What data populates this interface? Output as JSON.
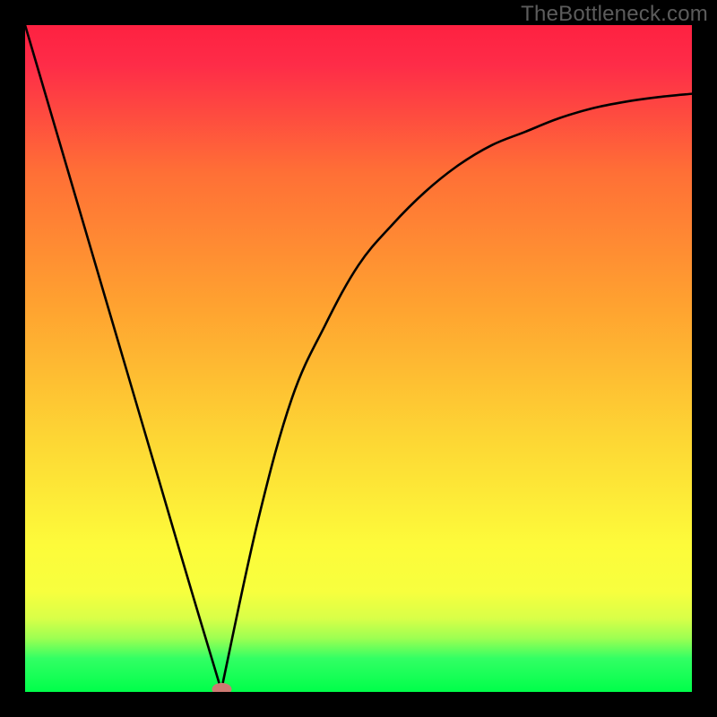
{
  "watermark": "TheBottleneck.com",
  "chart_data": {
    "type": "line",
    "x": [
      0,
      0.05,
      0.1,
      0.15,
      0.2,
      0.25,
      0.295,
      0.3,
      0.35,
      0.4,
      0.45,
      0.5,
      0.55,
      0.6,
      0.65,
      0.7,
      0.75,
      0.8,
      0.85,
      0.9,
      0.95,
      1.0
    ],
    "values": [
      100,
      83,
      66,
      49,
      32,
      15,
      0,
      3,
      26,
      44,
      55,
      64,
      70,
      75,
      79,
      82,
      84,
      86,
      87.5,
      88.5,
      89.2,
      89.7
    ],
    "title": "",
    "xlabel": "",
    "ylabel": "",
    "xlim": [
      0,
      1
    ],
    "ylim": [
      0,
      100
    ],
    "minimum_x": 0.295,
    "marker": {
      "x": 0.295,
      "y": 0,
      "color": "#cd7a72"
    },
    "background_gradient": {
      "top": "#fe2645",
      "mid_orange": "#ffa230",
      "mid_yellow": "#fdfb3a",
      "green_band": "#32ff64",
      "bottom": "#00ff4a"
    }
  }
}
